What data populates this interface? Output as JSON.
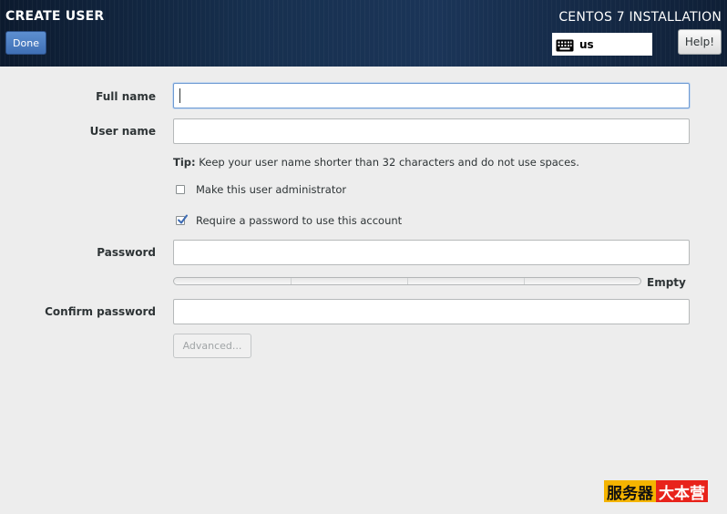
{
  "header": {
    "title": "CREATE USER",
    "product": "CENTOS 7 INSTALLATION",
    "done_label": "Done",
    "keyboard_layout": "us",
    "help_label": "Help!"
  },
  "form": {
    "fullname_label": "Full name",
    "fullname_value": "",
    "username_label": "User name",
    "username_value": "",
    "tip_prefix": "Tip:",
    "tip_text": " Keep your user name shorter than 32 characters and do not use spaces.",
    "admin_label": "Make this user administrator",
    "admin_checked": false,
    "require_pw_label": "Require a password to use this account",
    "require_pw_checked": true,
    "password_label": "Password",
    "password_value": "",
    "strength_label": "Empty",
    "strength_level": 0,
    "confirm_label": "Confirm password",
    "confirm_value": "",
    "advanced_label": "Advanced..."
  },
  "watermark": {
    "part1": "服务器",
    "part2": "大本营"
  },
  "colors": {
    "accent": "#3f6fb5",
    "header_bg": "#17304f",
    "page_bg": "#ededed"
  },
  "icons": {
    "keyboard": "keyboard-icon",
    "check": "checkmark-icon"
  }
}
